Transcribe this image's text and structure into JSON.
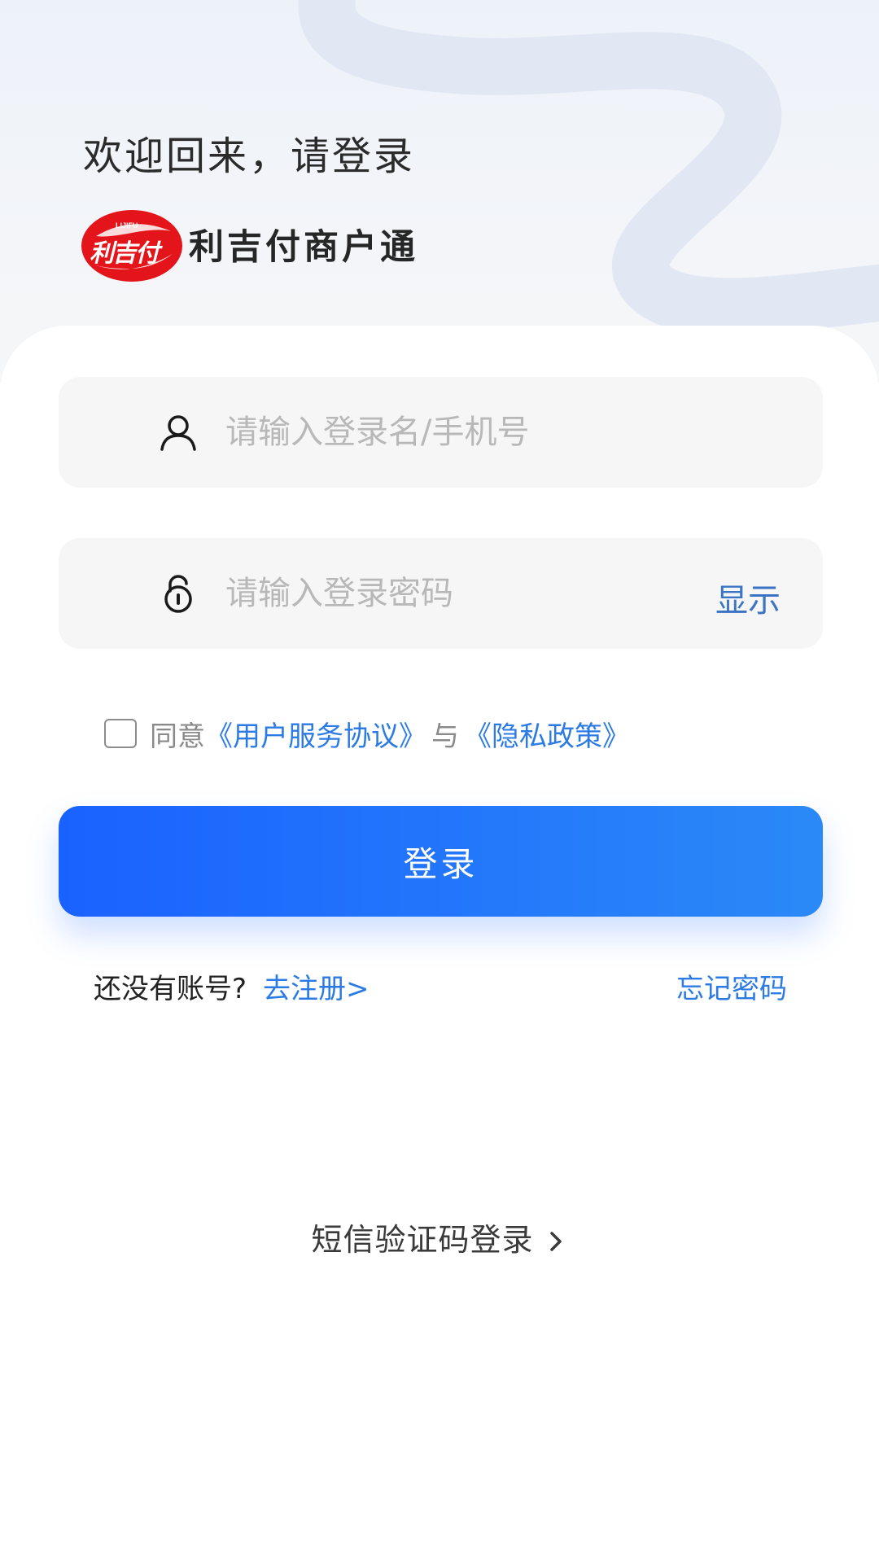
{
  "header": {
    "welcome_title": "欢迎回来，请登录",
    "logo": {
      "badge_text": "利吉付",
      "badge_subtext": "LIJIFU",
      "app_name": "利吉付商户通"
    }
  },
  "form": {
    "username": {
      "placeholder": "请输入登录名/手机号",
      "value": "",
      "icon": "user-icon"
    },
    "password": {
      "placeholder": "请输入登录密码",
      "value": "",
      "icon": "lock-icon",
      "toggle_label": "显示"
    },
    "agreement": {
      "checked": false,
      "prefix": "同意",
      "terms_link": "《用户服务协议》",
      "joiner": "与",
      "privacy_link": "《隐私政策》"
    },
    "login_button": "登录"
  },
  "links": {
    "no_account_prompt": "还没有账号?",
    "register": "去注册>",
    "forgot_password": "忘记密码",
    "sms_login": "短信验证码登录"
  },
  "colors": {
    "accent": "#2c7be5",
    "button_start": "#1a62ff",
    "button_end": "#2b89f7",
    "logo_red": "#e4141b"
  }
}
